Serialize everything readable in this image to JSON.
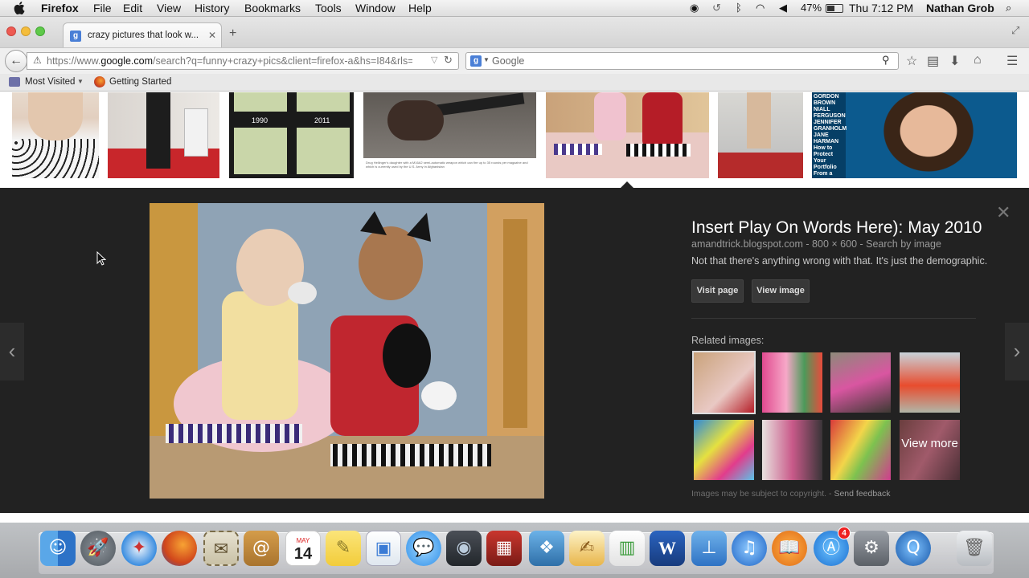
{
  "menubar": {
    "app_name": "Firefox",
    "items": [
      "File",
      "Edit",
      "View",
      "History",
      "Bookmarks",
      "Tools",
      "Window",
      "Help"
    ],
    "battery": "47%",
    "clock": "Thu 7:12 PM",
    "user": "Nathan Grob"
  },
  "tab": {
    "title": "crazy pictures that look w...",
    "favicon": "g"
  },
  "nav": {
    "url_prefix": "https://www.",
    "url_domain": "google.com",
    "url_rest": "/search?q=funny+crazy+pics&client=firefox-a&hs=I84&rls=",
    "search_placeholder": "Google",
    "search_engine_glyph": "g"
  },
  "bookmarks": {
    "most_visited": "Most Visited",
    "getting_started": "Getting Started"
  },
  "thumb_strip": {
    "caption_text": "Drug Hellinger's daughter with a M16A2 semi-automatic weapon which can fire up to 35 rounds per magazine and which is currently used by the U.S. Army in Afghanistan",
    "year_left": "1990",
    "year_right": "2011",
    "text_column": [
      "GORDON",
      "BROWN",
      "NIALL",
      "FERGUSON",
      "JENNIFER",
      "GRANHOLM",
      "JANE",
      "HARMAN",
      "How to",
      "Protect",
      "Your",
      "Portfolio",
      "From a"
    ]
  },
  "result": {
    "title": "Insert Play On Words Here): May 2010",
    "meta": "amandtrick.blogspot.com - 800 × 600 - Search by image",
    "description": "Not that there's anything wrong with that. It's just the demographic.",
    "visit_page": "Visit page",
    "view_image": "View image",
    "related_label": "Related images:",
    "view_more": "View more",
    "copyright_note": "Images may be subject to copyright.",
    "send_feedback": "Send feedback"
  },
  "dock": {
    "calendar_month": "MAY",
    "calendar_day": "14",
    "appstore_badge": "4"
  },
  "colors": {
    "panel_bg": "#222222",
    "accent_blue": "#4a7fd6",
    "menubar_bg": "#e9e9e9"
  }
}
